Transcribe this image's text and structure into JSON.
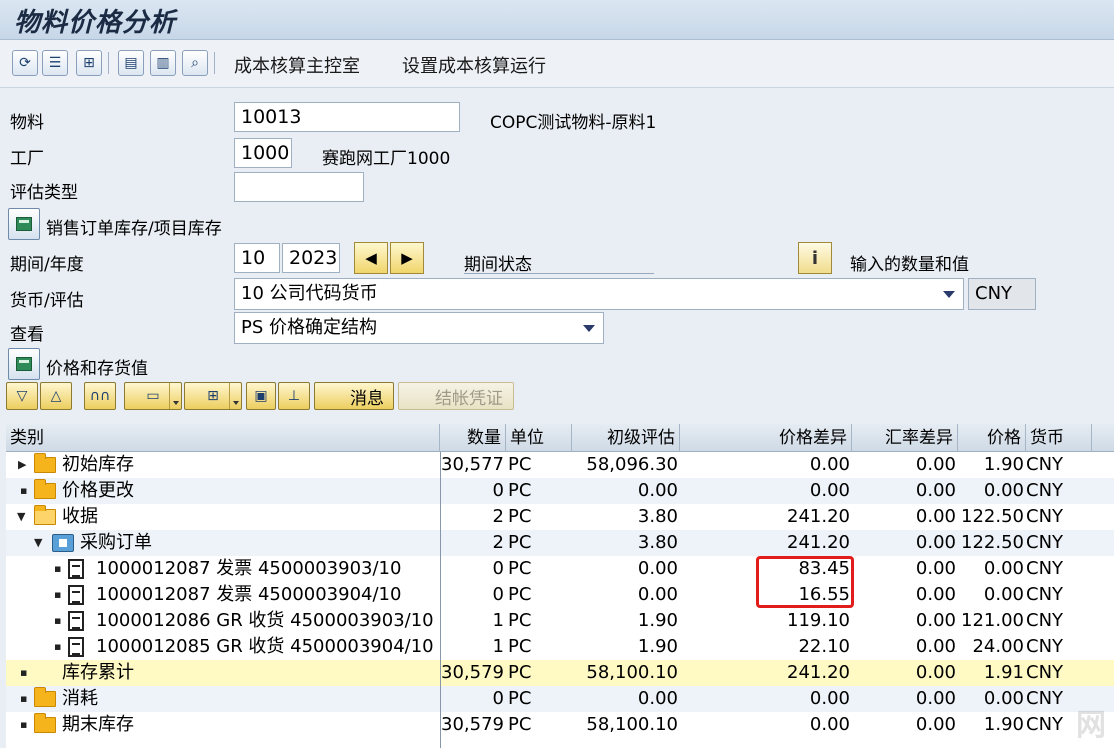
{
  "title": "物料价格分析",
  "toolbar": {
    "links": [
      "成本核算主控室",
      "设置成本核算运行"
    ]
  },
  "form": {
    "material_label": "物料",
    "material_value": "10013",
    "material_desc": "COPC测试物料-原料1",
    "plant_label": "工厂",
    "plant_value": "1000",
    "plant_desc": "赛跑网工厂1000",
    "valuation_type_label": "评估类型",
    "valuation_type_value": "",
    "sales_stock_label": "销售订单库存/项目库存",
    "period_label": "期间/年度",
    "period_value": "10",
    "year_value": "2023",
    "period_status_label": "期间状态",
    "qty_values_label": "输入的数量和值",
    "currency_label": "货币/评估",
    "currency_value": "10 公司代码货币",
    "currency_code": "CNY",
    "view_label": "查看",
    "view_value": "PS 价格确定结构",
    "price_stock_label": "价格和存货值"
  },
  "alv_toolbar": {
    "message_label": "消息",
    "post_label": "结帐凭证"
  },
  "table": {
    "headers": [
      "类别",
      "数量",
      "单位",
      "初级评估",
      "价格差异",
      "汇率差异",
      "价格",
      "货币"
    ],
    "rows": [
      {
        "name": "初始库存",
        "qty": "30,577",
        "unit": "PC",
        "primary": "58,096.30",
        "price_diff": "0.00",
        "fx_diff": "0.00",
        "price": "1.90",
        "cur": "CNY"
      },
      {
        "name": "价格更改",
        "qty": "0",
        "unit": "PC",
        "primary": "0.00",
        "price_diff": "0.00",
        "fx_diff": "0.00",
        "price": "0.00",
        "cur": "CNY"
      },
      {
        "name": "收据",
        "qty": "2",
        "unit": "PC",
        "primary": "3.80",
        "price_diff": "241.20",
        "fx_diff": "0.00",
        "price": "122.50",
        "cur": "CNY"
      },
      {
        "name": "采购订单",
        "qty": "2",
        "unit": "PC",
        "primary": "3.80",
        "price_diff": "241.20",
        "fx_diff": "0.00",
        "price": "122.50",
        "cur": "CNY"
      },
      {
        "name": "1000012087 发票 4500003903/10",
        "qty": "0",
        "unit": "PC",
        "primary": "0.00",
        "price_diff": "83.45",
        "fx_diff": "0.00",
        "price": "0.00",
        "cur": "CNY"
      },
      {
        "name": "1000012087 发票 4500003904/10",
        "qty": "0",
        "unit": "PC",
        "primary": "0.00",
        "price_diff": "16.55",
        "fx_diff": "0.00",
        "price": "0.00",
        "cur": "CNY"
      },
      {
        "name": "1000012086 GR 收货 4500003903/10",
        "qty": "1",
        "unit": "PC",
        "primary": "1.90",
        "price_diff": "119.10",
        "fx_diff": "0.00",
        "price": "121.00",
        "cur": "CNY"
      },
      {
        "name": "1000012085 GR 收货 4500003904/10",
        "qty": "1",
        "unit": "PC",
        "primary": "1.90",
        "price_diff": "22.10",
        "fx_diff": "0.00",
        "price": "24.00",
        "cur": "CNY"
      },
      {
        "name": "库存累计",
        "qty": "30,579",
        "unit": "PC",
        "primary": "58,100.10",
        "price_diff": "241.20",
        "fx_diff": "0.00",
        "price": "1.91",
        "cur": "CNY"
      },
      {
        "name": "消耗",
        "qty": "0",
        "unit": "PC",
        "primary": "0.00",
        "price_diff": "0.00",
        "fx_diff": "0.00",
        "price": "0.00",
        "cur": "CNY"
      },
      {
        "name": "期末库存",
        "qty": "30,579",
        "unit": "PC",
        "primary": "58,100.10",
        "price_diff": "0.00",
        "fx_diff": "0.00",
        "price": "1.90",
        "cur": "CNY"
      }
    ]
  },
  "watermark": "网"
}
